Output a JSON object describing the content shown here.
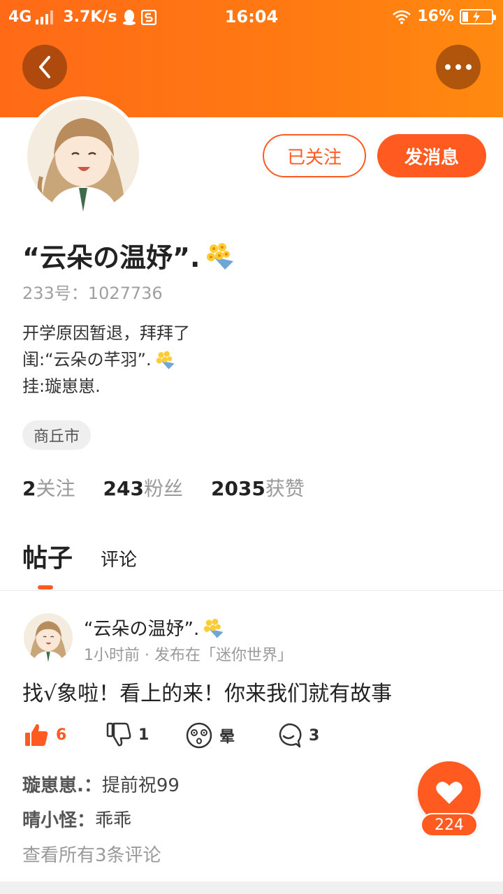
{
  "status_bar": {
    "network": "4G",
    "speed": "3.7K/s",
    "time": "16:04",
    "battery": "16%",
    "icons": [
      "signal-icon",
      "qq-icon",
      "s-icon",
      "wifi-icon",
      "battery-icon"
    ]
  },
  "header": {
    "back_icon": "chevron-left-icon",
    "more_icon": "more-dots-icon"
  },
  "profile": {
    "name": "“云朵の温妤”.",
    "id_line": "233号：1027736",
    "bio_line1": "开学原因暂退，拜拜了",
    "bio_line2": "闺:“云朵の芊羽”.",
    "bio_line3": "挂:璇崽崽.",
    "location": "商丘市",
    "follow_label": "已关注",
    "message_label": "发消息"
  },
  "stats": {
    "following_count": "2",
    "following_label": "关注",
    "fans_count": "243",
    "fans_label": "粉丝",
    "likes_count": "2035",
    "likes_label": "获赞"
  },
  "tabs": {
    "posts": "帖子",
    "comments": "评论"
  },
  "post": {
    "author": "“云朵の温妤”.",
    "meta": "1小时前 · 发布在「迷你世界」",
    "text": "找√象啦！看上的来！你来我们就有故事",
    "like_count": "6",
    "dislike_count": "1",
    "dizzy_label": "晕",
    "comment_count": "3",
    "comments": [
      {
        "user": "璇崽崽.：",
        "text": "提前祝99"
      },
      {
        "user": "晴小怪：",
        "text": "乖乖"
      }
    ],
    "view_all": "查看所有3条评论"
  },
  "fab": {
    "count": "224",
    "icon": "heart-icon"
  },
  "colors": {
    "accent": "#ff5a1f",
    "header_gradient_start": "#ff6a17",
    "header_gradient_end": "#ff8a10"
  }
}
